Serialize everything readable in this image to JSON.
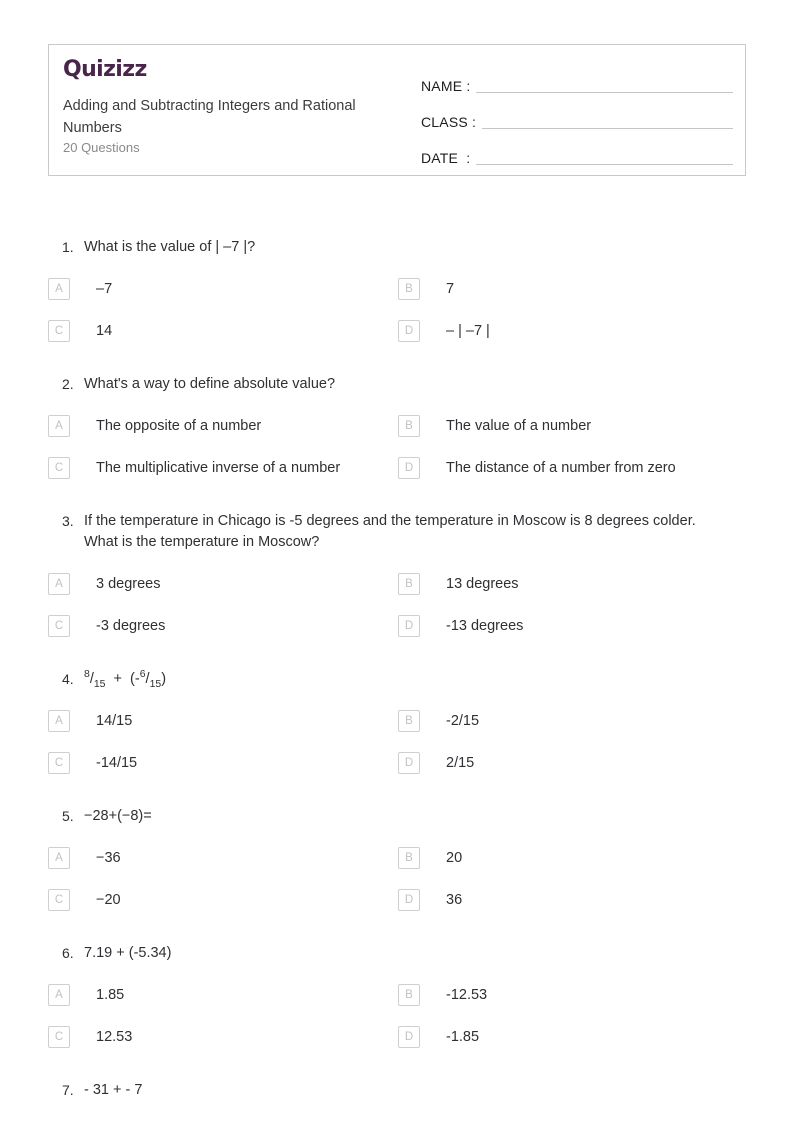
{
  "header": {
    "brand": "Quizizz",
    "title": "Adding and Subtracting Integers and Rational Numbers",
    "question_count": "20 Questions",
    "fields": [
      {
        "label": "NAME :"
      },
      {
        "label": "CLASS :"
      },
      {
        "label": "DATE  :"
      }
    ]
  },
  "colors": {
    "brand": "#47264a",
    "text": "#2f3033",
    "muted": "#8a8a8a",
    "border": "#c9c9c9",
    "option_box_border": "#cfcfcf",
    "option_letter": "#c2c2c2"
  },
  "option_letters": [
    "A",
    "B",
    "C",
    "D"
  ],
  "questions": [
    {
      "number": "1.",
      "text": "What is the value of | –7 |?",
      "options": [
        "–7",
        "7",
        "14",
        "– | –7 |"
      ]
    },
    {
      "number": "2.",
      "text": "What's a way to define absolute value?",
      "options": [
        "The opposite of a number",
        "The value of a number",
        "The multiplicative inverse of a number",
        "The distance of a number from zero"
      ]
    },
    {
      "number": "3.",
      "text": "If the temperature in Chicago is -5 degrees and the temperature in Moscow is 8 degrees colder. What is the temperature in Moscow?",
      "options": [
        "3 degrees",
        "13 degrees",
        "-3 degrees",
        "-13 degrees"
      ]
    },
    {
      "number": "4.",
      "text_html": "<sup>8</sup>/<sub>15</sub> &nbsp;+&nbsp; (-<sup>6</sup>/<sub>15</sub>)",
      "text": "8/15 + (-6/15)",
      "options": [
        "14/15",
        "-2/15",
        "-14/15",
        "2/15"
      ]
    },
    {
      "number": "5.",
      "text": "−28+(−8)=",
      "options": [
        "−36",
        "20",
        "−20",
        "36"
      ]
    },
    {
      "number": "6.",
      "text": "7.19 + (-5.34)",
      "options": [
        "1.85",
        "-12.53",
        "12.53",
        "-1.85"
      ]
    },
    {
      "number": "7.",
      "text": "- 31 + - 7",
      "options": []
    }
  ]
}
